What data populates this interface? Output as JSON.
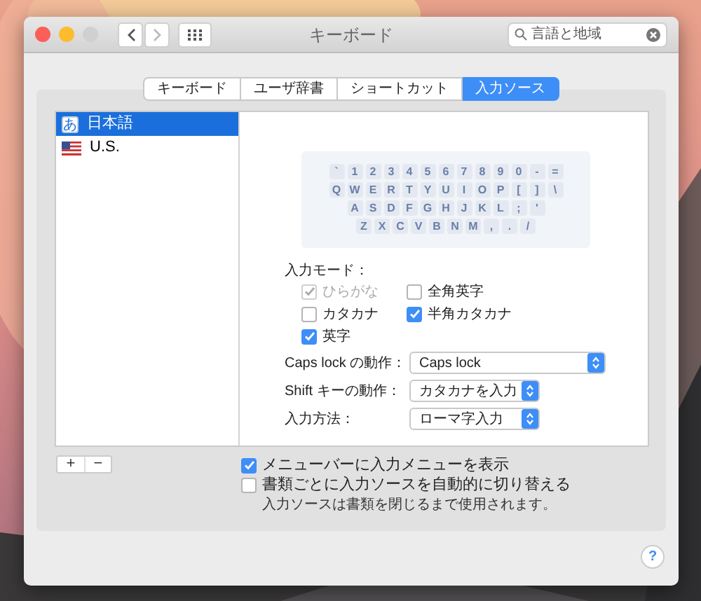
{
  "window": {
    "title": "キーボード",
    "search": {
      "value": "言語と地域"
    }
  },
  "tabs": [
    {
      "label": "キーボード",
      "selected": false
    },
    {
      "label": "ユーザ辞書",
      "selected": false
    },
    {
      "label": "ショートカット",
      "selected": false
    },
    {
      "label": "入力ソース",
      "selected": true
    }
  ],
  "input_sources": [
    {
      "kind": "kana",
      "icon": "あ",
      "label": "日本語",
      "selected": true
    },
    {
      "kind": "flag",
      "label": "U.S.",
      "selected": false
    }
  ],
  "keyboard": {
    "rows": [
      {
        "keys": [
          "`",
          "1",
          "2",
          "3",
          "4",
          "5",
          "6",
          "7",
          "8",
          "9",
          "0",
          "-",
          "="
        ]
      },
      {
        "keys": [
          "Q",
          "W",
          "E",
          "R",
          "T",
          "Y",
          "U",
          "I",
          "O",
          "P",
          "[",
          "]",
          "\\"
        ]
      },
      {
        "keys": [
          "A",
          "S",
          "D",
          "F",
          "G",
          "H",
          "J",
          "K",
          "L",
          ";",
          "'"
        ]
      },
      {
        "keys": [
          "Z",
          "X",
          "C",
          "V",
          "B",
          "N",
          "M",
          ",",
          ".",
          "/"
        ]
      }
    ]
  },
  "input_mode": {
    "label": "入力モード：",
    "options": [
      {
        "label": "ひらがな",
        "checked": true,
        "disabled": true
      },
      {
        "label": "全角英字",
        "checked": false,
        "disabled": false
      },
      {
        "label": "カタカナ",
        "checked": false,
        "disabled": false
      },
      {
        "label": "半角カタカナ",
        "checked": true,
        "disabled": false
      },
      {
        "label": "英字",
        "checked": true,
        "disabled": false
      }
    ]
  },
  "settings": [
    {
      "label": "Caps lock の動作：",
      "value": "Caps lock"
    },
    {
      "label": "Shift キーの動作：",
      "value": "カタカナを入力"
    },
    {
      "label": "入力方法：",
      "value": "ローマ字入力"
    }
  ],
  "list_buttons": [
    "+",
    "−"
  ],
  "options": [
    {
      "label": "メニューバーに入力メニューを表示",
      "checked": true
    },
    {
      "label": "書類ごとに入力ソースを自動的に切り替える",
      "checked": false
    }
  ],
  "note": "入力ソースは書類を閉じるまで使用されます。",
  "help": "?"
}
